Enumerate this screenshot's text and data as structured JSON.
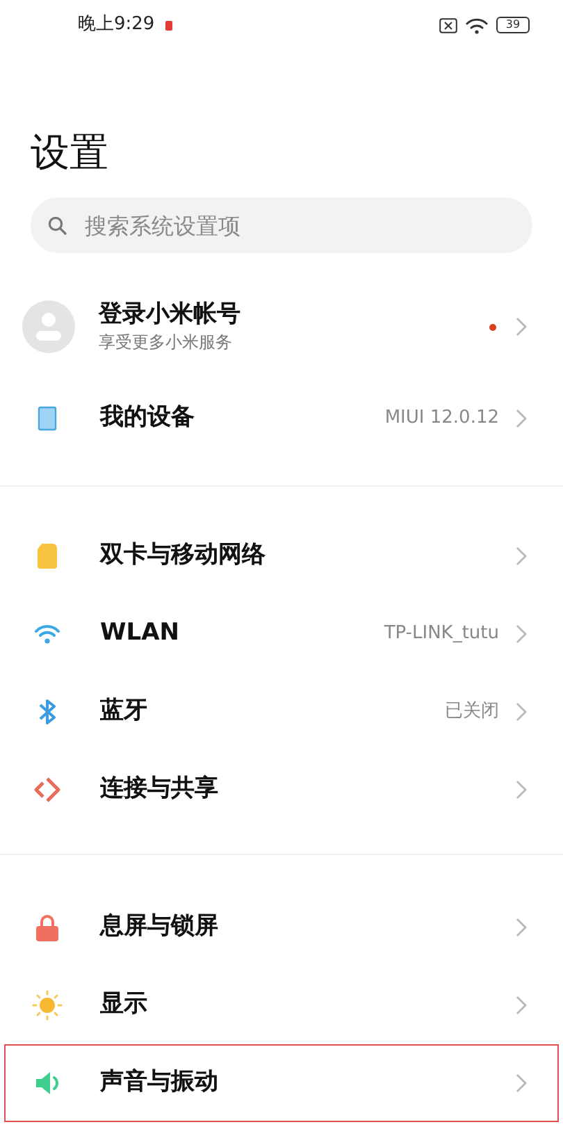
{
  "status_bar": {
    "time": "晚上9:29",
    "battery": "39"
  },
  "title": "设置",
  "search": {
    "placeholder": "搜索系统设置项"
  },
  "sections": [
    {
      "items": [
        {
          "kind": "account",
          "label": "登录小米帐号",
          "subtitle": "享受更多小米服务",
          "notification": true,
          "highlighted": false
        },
        {
          "kind": "row",
          "label": "我的设备",
          "value": "MIUI 12.0.12",
          "highlighted": false
        }
      ]
    },
    {
      "items": [
        {
          "kind": "row",
          "label": "双卡与移动网络",
          "highlighted": false
        },
        {
          "kind": "row",
          "label": "WLAN",
          "value": "TP-LINK_tutu",
          "highlighted": false
        },
        {
          "kind": "row",
          "label": "蓝牙",
          "value": "已关闭",
          "highlighted": false
        },
        {
          "kind": "row",
          "label": "连接与共享",
          "highlighted": false
        }
      ]
    },
    {
      "items": [
        {
          "kind": "row",
          "label": "息屏与锁屏",
          "highlighted": false
        },
        {
          "kind": "row",
          "label": "显示",
          "highlighted": false
        },
        {
          "kind": "row",
          "label": "声音与振动",
          "highlighted": true
        }
      ]
    }
  ]
}
